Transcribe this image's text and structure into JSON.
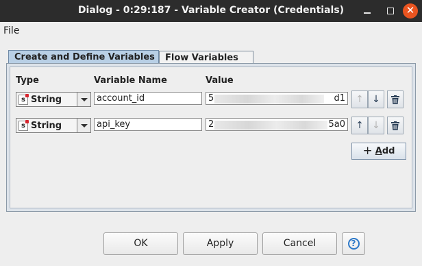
{
  "window": {
    "title": "Dialog - 0:29:187 - Variable Creator (Credentials)",
    "minimize_icon": "minimize-icon",
    "maximize_icon": "maximize-icon",
    "close_glyph": "✕"
  },
  "menu": {
    "file": "File"
  },
  "tabs": [
    {
      "label": "Create and Define Variables",
      "active": true
    },
    {
      "label": "Flow Variables",
      "active": false
    }
  ],
  "table": {
    "headers": {
      "type": "Type",
      "name": "Variable Name",
      "value": "Value"
    },
    "rows": [
      {
        "type": "String",
        "type_icon": "s",
        "name": "account_id",
        "value_start": "5",
        "value_end": "d1",
        "up_enabled": false,
        "down_enabled": true
      },
      {
        "type": "String",
        "type_icon": "s",
        "name": "api_key",
        "value_start": "2",
        "value_end": "5a0",
        "up_enabled": true,
        "down_enabled": false
      }
    ]
  },
  "glyphs": {
    "up": "↑",
    "down": "↓",
    "delete": "🗑",
    "plus": "+",
    "help": "?"
  },
  "add_button": {
    "label_underlined": "A",
    "label_rest": "dd"
  },
  "buttons": {
    "ok": "OK",
    "apply": "Apply",
    "cancel": "Cancel"
  },
  "colors": {
    "titlebar": "#2c2c2c",
    "close_button": "#e95420",
    "active_tab": "#b8cfe5",
    "help_accent": "#2c78c8"
  }
}
